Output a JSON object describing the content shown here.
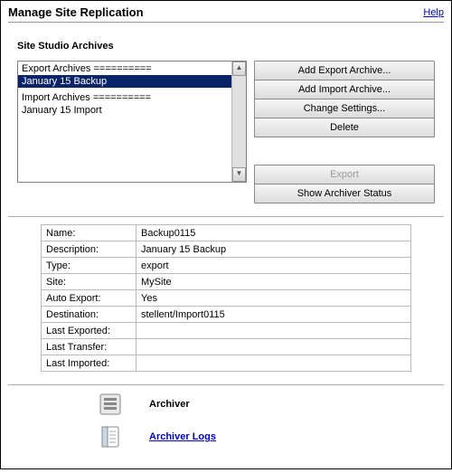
{
  "header": {
    "title": "Manage Site Replication",
    "help": "Help"
  },
  "section_label": "Site Studio Archives",
  "list": {
    "group_export": "Export Archives ==========",
    "item_selected": "January 15 Backup",
    "group_import": "Import Archives ==========",
    "item_import": "January 15 Import"
  },
  "buttons": {
    "add_export": "Add Export Archive...",
    "add_import": "Add Import Archive...",
    "change_settings": "Change Settings...",
    "delete": "Delete",
    "export": "Export",
    "show_status": "Show Archiver Status"
  },
  "details": {
    "name_k": "Name:",
    "name_v": "Backup0115",
    "desc_k": "Description:",
    "desc_v": "January 15 Backup",
    "type_k": "Type:",
    "type_v": "export",
    "site_k": "Site:",
    "site_v": "MySite",
    "auto_k": "Auto Export:",
    "auto_v": "Yes",
    "dest_k": "Destination:",
    "dest_v": "stellent/Import0115",
    "lexp_k": "Last Exported:",
    "lexp_v": "",
    "ltra_k": "Last Transfer:",
    "ltra_v": "",
    "limp_k": "Last Imported:",
    "limp_v": ""
  },
  "footer": {
    "archiver": "Archiver",
    "archiver_logs": "Archiver Logs"
  }
}
